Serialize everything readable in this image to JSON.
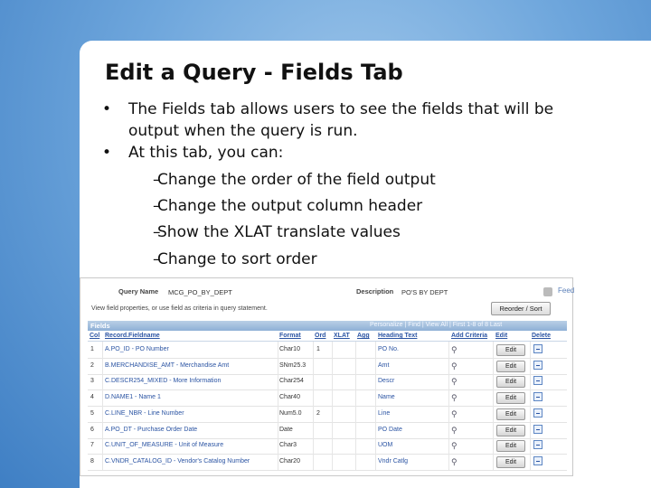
{
  "slide": {
    "title": "Edit a Query - Fields Tab",
    "bullets": [
      {
        "line1": "The Fields tab allows users to see the fields that will be",
        "line2": "output when the query is run."
      },
      {
        "line1": "At this tab, you can:"
      }
    ],
    "subbullets": [
      "Change the order of the field output",
      "Change the output column header",
      "Show the XLAT translate values",
      "Change to sort order"
    ]
  },
  "query": {
    "name_label": "Query Name",
    "name_value": "MCG_PO_BY_DEPT",
    "description_label": "Description",
    "description_value": "PO'S BY DEPT",
    "feed_label": "Feed",
    "reorder_label": "Reorder / Sort",
    "instruction": "View field properties, or use field as criteria in query statement."
  },
  "grid": {
    "title": "Fields",
    "pagination": "Personalize | Find | View All |   First  1-8 of 8  Last",
    "columns": [
      "Col",
      "Record.Fieldname",
      "Format",
      "Ord",
      "XLAT",
      "Agg",
      "Heading Text",
      "Add Criteria",
      "Edit",
      "Delete"
    ],
    "edit_label": "Edit",
    "rows": [
      {
        "col": "1",
        "field": "A.PO_ID - PO Number",
        "format": "Char10",
        "ord": "1",
        "xlat": "",
        "agg": "",
        "heading": "PO No."
      },
      {
        "col": "2",
        "field": "B.MERCHANDISE_AMT - Merchandise Amt",
        "format": "SNm25.3",
        "ord": "",
        "xlat": "",
        "agg": "",
        "heading": "Amt"
      },
      {
        "col": "3",
        "field": "C.DESCR254_MIXED - More Information",
        "format": "Char254",
        "ord": "",
        "xlat": "",
        "agg": "",
        "heading": "Descr"
      },
      {
        "col": "4",
        "field": "D.NAME1 - Name 1",
        "format": "Char40",
        "ord": "",
        "xlat": "",
        "agg": "",
        "heading": "Name"
      },
      {
        "col": "5",
        "field": "C.LINE_NBR - Line Number",
        "format": "Num5.0",
        "ord": "2",
        "xlat": "",
        "agg": "",
        "heading": "Line"
      },
      {
        "col": "6",
        "field": "A.PO_DT - Purchase Order Date",
        "format": "Date",
        "ord": "",
        "xlat": "",
        "agg": "",
        "heading": "PO Date"
      },
      {
        "col": "7",
        "field": "C.UNIT_OF_MEASURE - Unit of Measure",
        "format": "Char3",
        "ord": "",
        "xlat": "",
        "agg": "",
        "heading": "UOM"
      },
      {
        "col": "8",
        "field": "C.VNDR_CATALOG_ID - Vendor's Catalog Number",
        "format": "Char20",
        "ord": "",
        "xlat": "",
        "agg": "",
        "heading": "Vndr Catlg"
      }
    ]
  }
}
